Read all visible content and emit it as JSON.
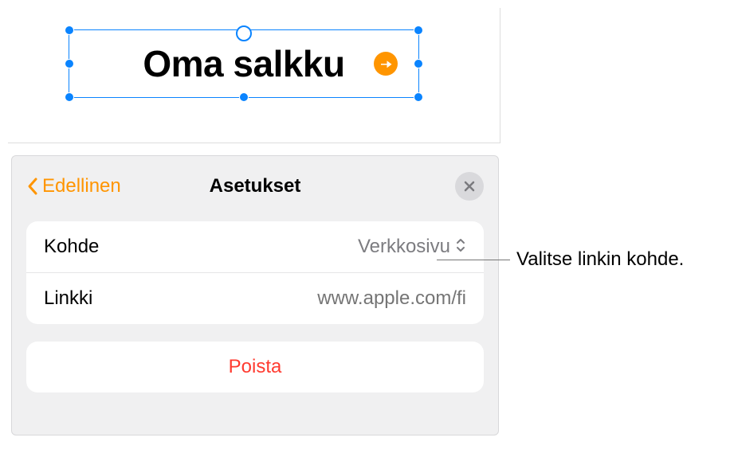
{
  "canvas": {
    "title_text": "Oma salkku"
  },
  "popover": {
    "back_label": "Edellinen",
    "title": "Asetukset",
    "rows": {
      "target": {
        "label": "Kohde",
        "value": "Verkkosivu"
      },
      "link": {
        "label": "Linkki",
        "placeholder": "www.apple.com/fi"
      }
    },
    "delete_label": "Poista"
  },
  "callout": {
    "text": "Valitse linkin kohde."
  }
}
